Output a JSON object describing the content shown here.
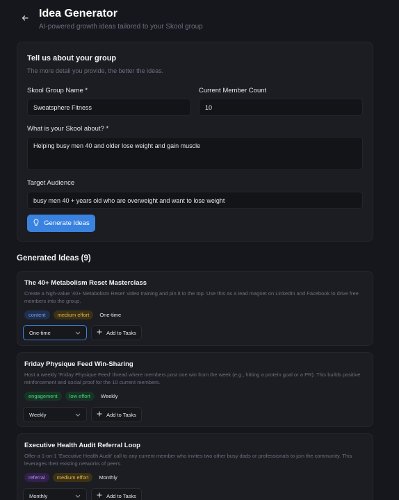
{
  "header": {
    "title": "Idea Generator",
    "subtitle": "AI-powered growth ideas tailored to your Skool group"
  },
  "form": {
    "title": "Tell us about your group",
    "subtitle": "The more detail you provide, the better the ideas.",
    "group_name_label": "Skool Group Name *",
    "group_name_value": "Sweatsphere Fitness",
    "member_count_label": "Current Member Count",
    "member_count_value": "10",
    "about_label": "What is your Skool about? *",
    "about_value": "Helping busy men 40 and older lose weight and gain muscle",
    "audience_label": "Target Audience",
    "audience_value": "busy men 40 + years old who are overweight and want to lose weight",
    "generate_label": "Generate Ideas"
  },
  "ideas_section": {
    "title": "Generated Ideas (9)"
  },
  "ideas": [
    {
      "title": "The 40+ Metabolism Reset Masterclass",
      "description": "Create a high-value '40+ Metabolism Reset' video training and pin it to the top. Use this as a lead magnet on LinkedIn and Facebook to drive free members into the group.",
      "tag_type": "content",
      "tag_effort": "medium effort",
      "frequency": "One-time",
      "select_value": "One-time",
      "add_label": "Add to Tasks"
    },
    {
      "title": "Friday Physique Feed Win-Sharing",
      "description": "Host a weekly 'Friday Physique Feed' thread where members post one win from the week (e.g., hitting a protein goal or a PR). This builds positive reinforcement and social proof for the 10 current members.",
      "tag_type": "engagement",
      "tag_effort": "low effort",
      "frequency": "Weekly",
      "select_value": "Weekly",
      "add_label": "Add to Tasks"
    },
    {
      "title": "Executive Health Audit Referral Loop",
      "description": "Offer a 1-on-1 'Executive Health Audit' call to any current member who invites two other busy dads or professionals to join the community. This leverages their existing networks of peers.",
      "tag_type": "referral",
      "tag_effort": "medium effort",
      "frequency": "Monthly",
      "select_value": "Monthly",
      "add_label": "Add to Tasks"
    }
  ],
  "colors": {
    "accent": "#3a82e0",
    "background": "#16171c",
    "card": "#1c1d22"
  }
}
